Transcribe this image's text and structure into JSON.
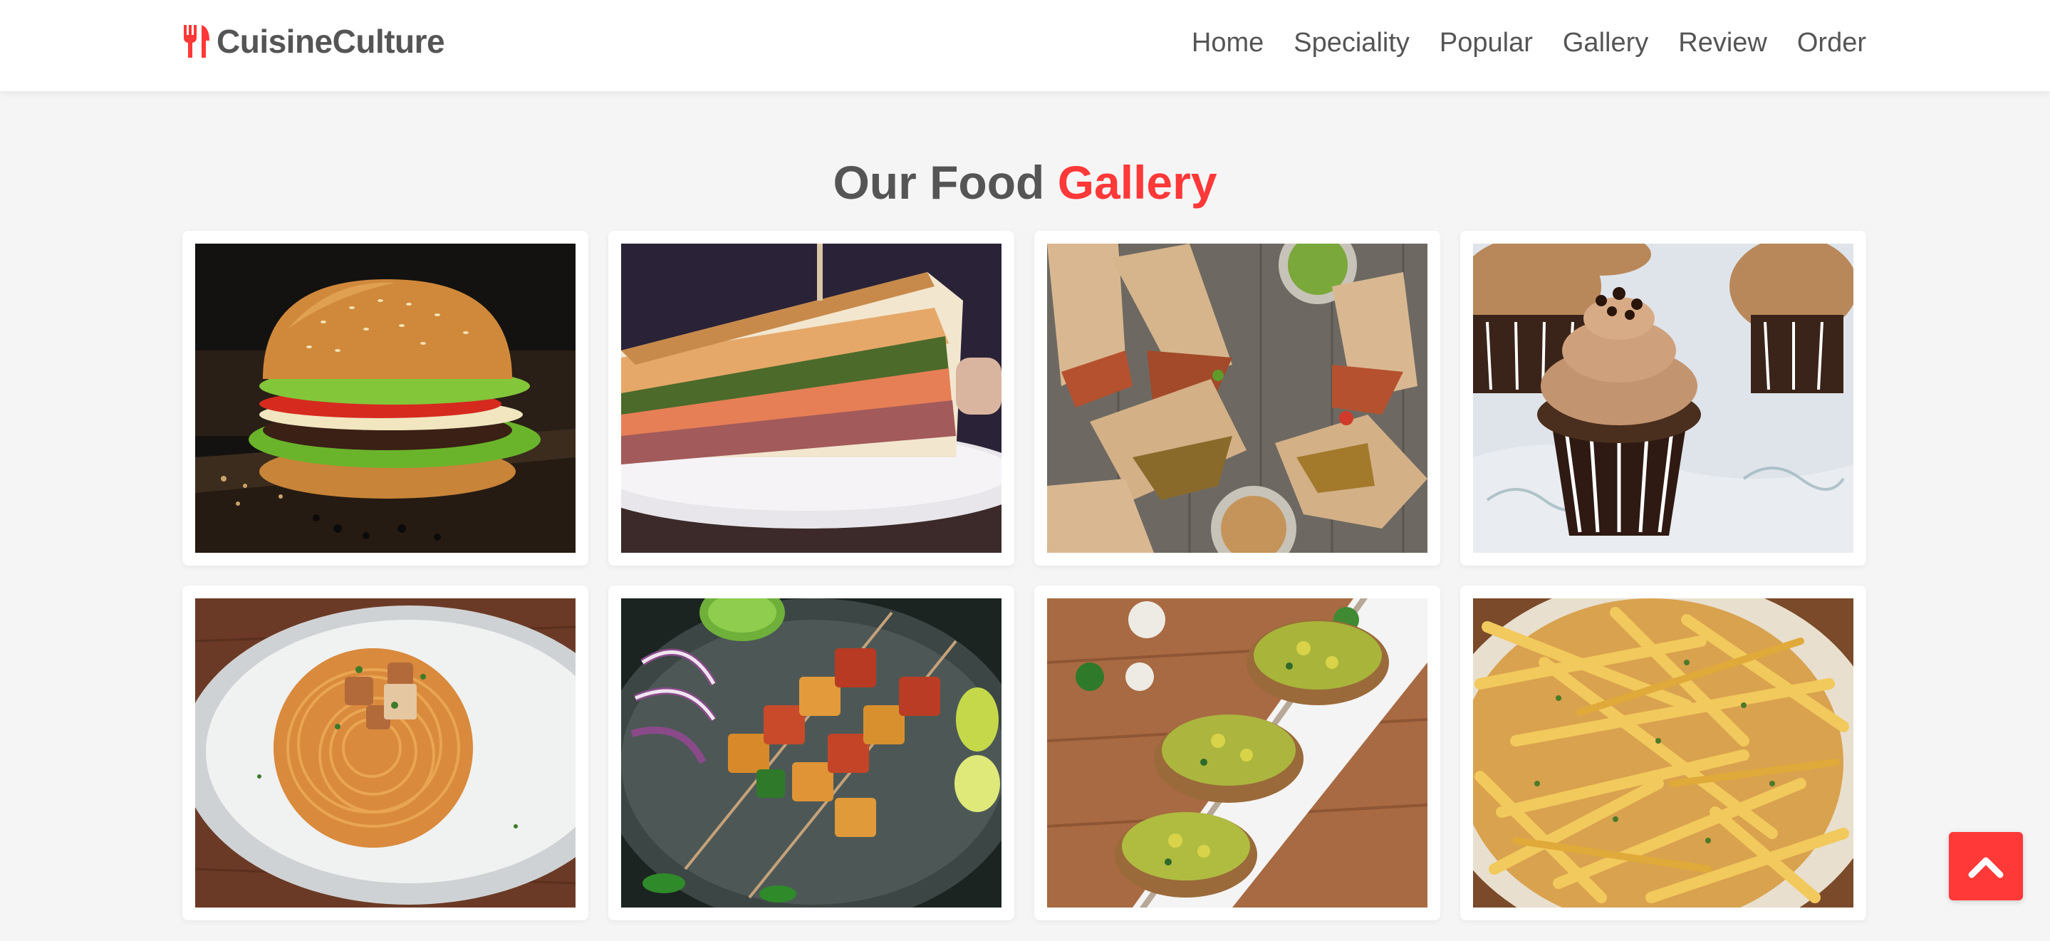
{
  "header": {
    "logo_text": "CuisineCulture",
    "logo_icon": "utensils-icon",
    "nav": [
      "Home",
      "Speciality",
      "Popular",
      "Gallery",
      "Review",
      "Order"
    ]
  },
  "gallery": {
    "heading_main": "Our Food",
    "heading_accent": "Gallery",
    "items": [
      {
        "icon": "burger-photo"
      },
      {
        "icon": "sandwich-photo"
      },
      {
        "icon": "wraps-photo"
      },
      {
        "icon": "cupcake-photo"
      },
      {
        "icon": "spaghetti-photo"
      },
      {
        "icon": "paneer-tikka-photo"
      },
      {
        "icon": "bruschetta-photo"
      },
      {
        "icon": "fries-photo"
      }
    ]
  },
  "scroll_top": {
    "icon": "chevron-up-icon"
  },
  "colors": {
    "accent": "#ff3838",
    "text": "#555555",
    "background": "#f5f5f5"
  }
}
